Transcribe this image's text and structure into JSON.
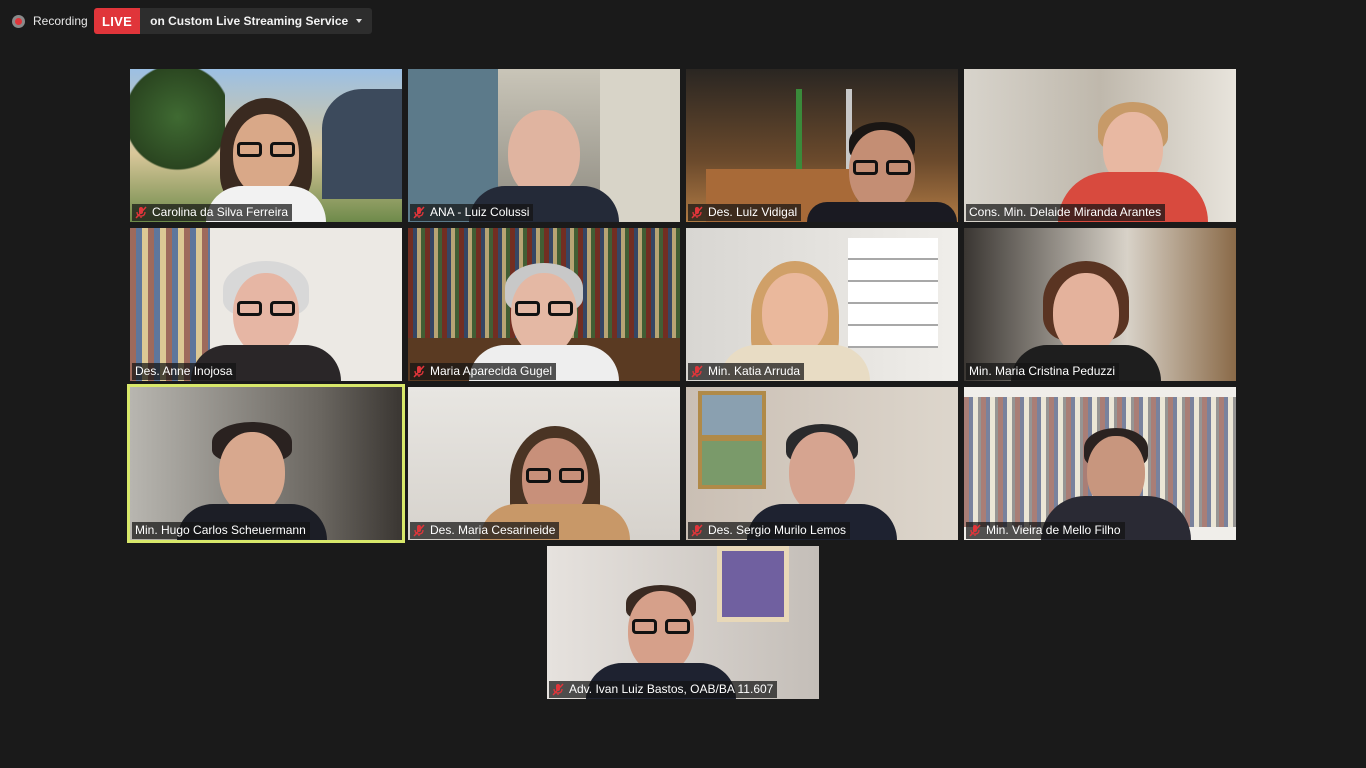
{
  "topbar": {
    "recording_label": "Recording",
    "live_label": "LIVE",
    "live_service_label": "on Custom Live Streaming Service"
  },
  "tiles": [
    {
      "name": "Carolina da Silva Ferreira",
      "muted": true
    },
    {
      "name": "ANA - Luiz Colussi",
      "muted": true
    },
    {
      "name": "Des. Luiz Vidigal",
      "muted": true
    },
    {
      "name": "Cons. Min. Delaide Miranda Arantes",
      "muted": false
    },
    {
      "name": "Des. Anne Inojosa",
      "muted": false
    },
    {
      "name": "Maria Aparecida Gugel",
      "muted": true
    },
    {
      "name": "Min. Katia Arruda",
      "muted": true
    },
    {
      "name": "Min. Maria Cristina Peduzzi",
      "muted": false
    },
    {
      "name": "Min. Hugo Carlos Scheuermann",
      "muted": false,
      "active_speaker": true
    },
    {
      "name": "Des. Maria Cesarineide",
      "muted": true
    },
    {
      "name": "Des. Sergio Murilo Lemos",
      "muted": true
    },
    {
      "name": "Min. Vieira de Mello Filho",
      "muted": true
    },
    {
      "name": "Adv. Ivan Luiz Bastos, OAB/BA 11.607",
      "muted": true
    }
  ],
  "colors": {
    "background": "#1a1a1a",
    "live_red": "#e0353a",
    "active_speaker_border": "#d8e86a",
    "muted_mic": "#e0353a"
  },
  "icons": {
    "recording": "recording-dot-icon",
    "dropdown": "chevron-down-icon",
    "muted": "muted-mic-icon"
  }
}
